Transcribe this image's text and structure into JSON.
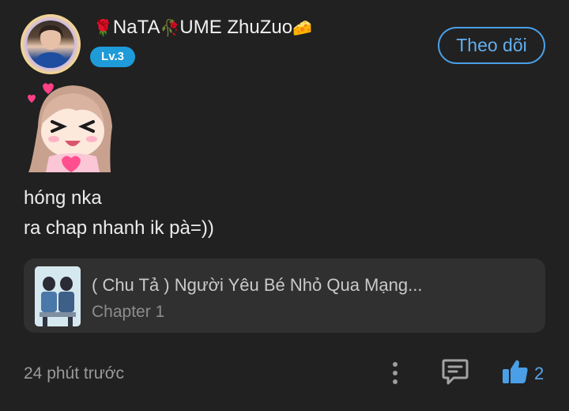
{
  "user": {
    "name_prefix_emoji": "🌹",
    "name_part1": "NaTA",
    "name_mid_emoji": "🥀",
    "name_part2": "UME ZhuZuo",
    "name_suffix_emoji": "🧀",
    "level": "Lv.3",
    "follow_label": "Theo dõi"
  },
  "comment": {
    "line1": "hóng nka",
    "line2": "ra chap nhanh ik pà=))",
    "sticker_icon": "crying-laughing-girl-sticker"
  },
  "story": {
    "title": "( Chu Tả ) Người Yêu Bé Nhỏ Qua Mạng...",
    "chapter": "Chapter 1"
  },
  "footer": {
    "timestamp": "24 phút trước",
    "like_count": "2"
  },
  "colors": {
    "background": "#212121",
    "accent": "#4a9fe6",
    "level_badge": "#1e9bd8",
    "card": "#303030"
  }
}
